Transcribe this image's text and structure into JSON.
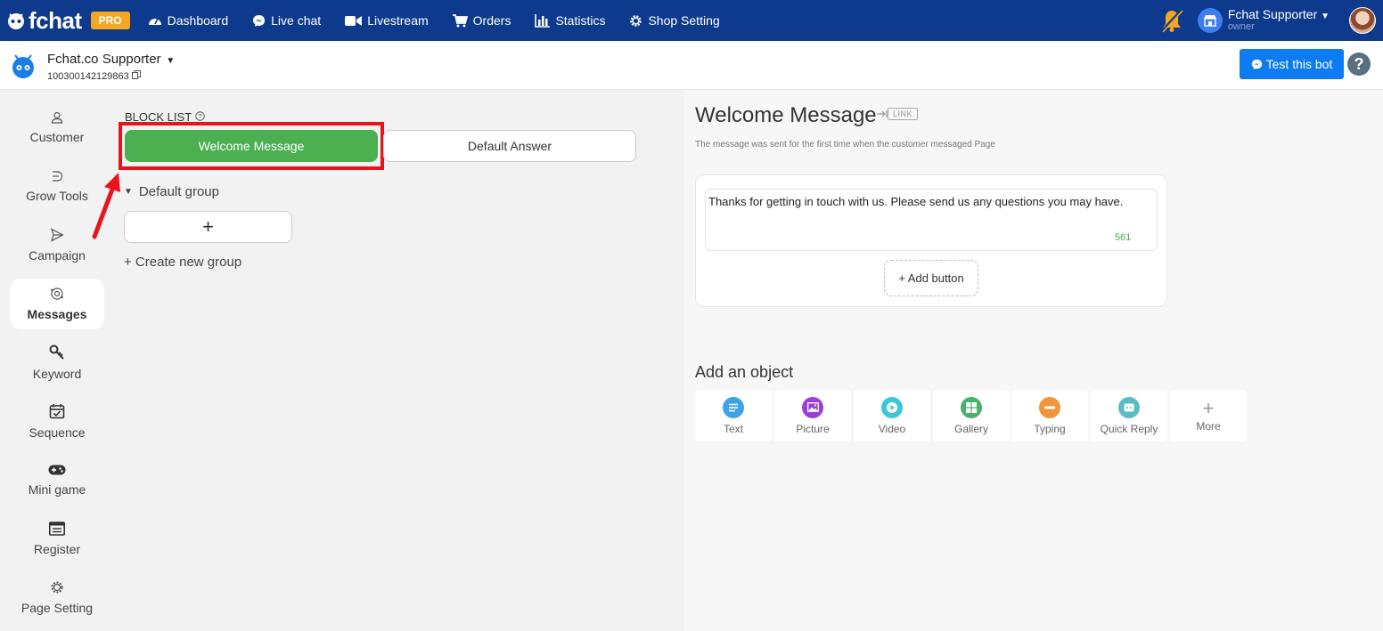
{
  "brand": {
    "name": "fchat",
    "badge": "PRO"
  },
  "nav": {
    "items": [
      {
        "label": "Dashboard",
        "icon": "dashboard-icon"
      },
      {
        "label": "Live chat",
        "icon": "messenger-icon"
      },
      {
        "label": "Livestream",
        "icon": "video-icon"
      },
      {
        "label": "Orders",
        "icon": "cart-icon"
      },
      {
        "label": "Statistics",
        "icon": "bar-chart-icon"
      },
      {
        "label": "Shop Setting",
        "icon": "gear-icon"
      }
    ]
  },
  "user": {
    "name": "Fchat Supporter",
    "role": "owner"
  },
  "page": {
    "name": "Fchat.co Supporter",
    "id": "100300142129863"
  },
  "header": {
    "test_bot_label": "Test this bot",
    "help": "?"
  },
  "sidebar": {
    "items": [
      {
        "label": "Customer",
        "icon": "user-icon"
      },
      {
        "label": "Grow Tools",
        "icon": "grow-tools-icon"
      },
      {
        "label": "Campaign",
        "icon": "send-icon"
      },
      {
        "label": "Messages",
        "icon": "messages-icon"
      },
      {
        "label": "Keyword",
        "icon": "key-icon"
      },
      {
        "label": "Sequence",
        "icon": "calendar-check-icon"
      },
      {
        "label": "Mini game",
        "icon": "gamepad-icon"
      },
      {
        "label": "Register",
        "icon": "register-icon"
      },
      {
        "label": "Page Setting",
        "icon": "gear-icon"
      }
    ],
    "active": "Messages"
  },
  "block_list": {
    "title": "BLOCK LIST",
    "blocks": [
      "Welcome Message",
      "Default Answer"
    ],
    "group_name": "Default group",
    "add_symbol": "+",
    "create_group_label": "+ Create new group"
  },
  "editor": {
    "title": "Welcome Message",
    "link_badge": "LINK",
    "description": "The message was sent for the first time when the customer messaged Page",
    "message_text": "Thanks for getting in touch with us. Please send us any questions you may have.",
    "char_count": "561",
    "add_button_label": "+ Add button"
  },
  "objects": {
    "title": "Add an object",
    "items": [
      {
        "label": "Text",
        "icon": "text-icon",
        "color": "#3ba3e8"
      },
      {
        "label": "Picture",
        "icon": "picture-icon",
        "color": "#9b3fd6"
      },
      {
        "label": "Video",
        "icon": "play-icon",
        "color": "#3cc8d8"
      },
      {
        "label": "Gallery",
        "icon": "gallery-icon",
        "color": "#4caf6e"
      },
      {
        "label": "Typing",
        "icon": "typing-icon",
        "color": "#f0953a"
      },
      {
        "label": "Quick Reply",
        "icon": "quick-reply-icon",
        "color": "#5bbcc8"
      },
      {
        "label": "More",
        "icon": "plus-icon",
        "color": "#999999"
      }
    ]
  },
  "colors": {
    "navbar": "#0d3a8c",
    "primary": "#0d7cf2",
    "active_block": "#4caf50",
    "highlight": "#e8141c"
  }
}
